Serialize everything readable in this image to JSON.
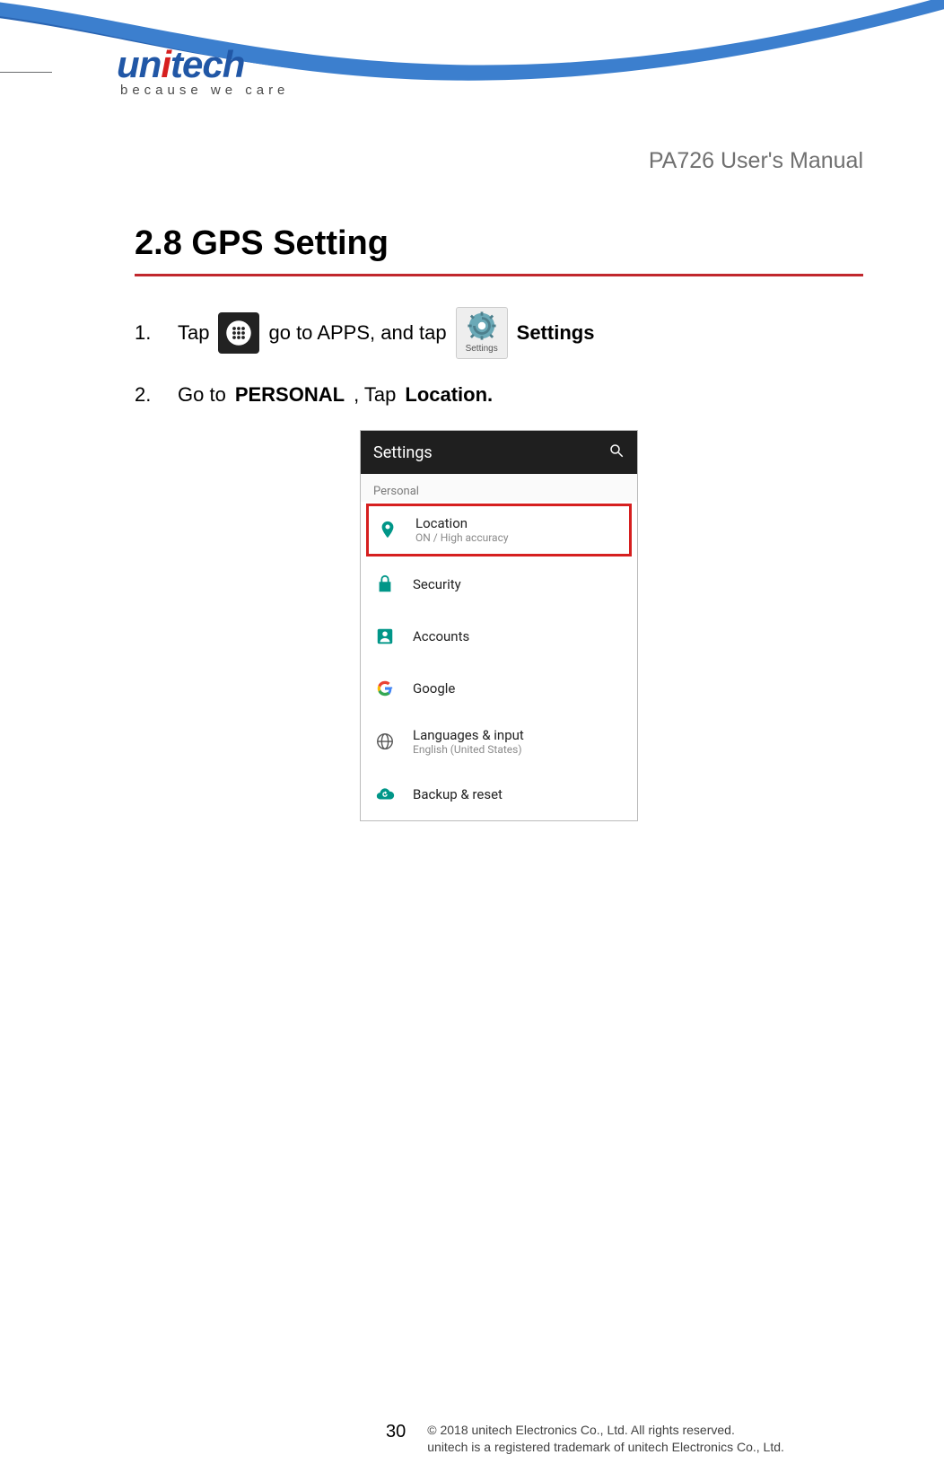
{
  "header": {
    "logo_text_parts": {
      "pre": "un",
      "i": "i",
      "post": "tech"
    },
    "logo_tagline": "because we care",
    "manual_title": "PA726 User's Manual"
  },
  "section": {
    "heading": "2.8 GPS Setting"
  },
  "steps": [
    {
      "num": "1.",
      "pre": "Tap",
      "mid": "go to APPS, and tap",
      "icon1_name": "apps-icon",
      "icon2_name": "settings-app-icon",
      "icon2_label": "Settings",
      "post_bold": "Settings"
    },
    {
      "num": "2.",
      "pre": "Go to",
      "bold1": "PERSONAL",
      "mid": " , Tap ",
      "bold2": "Location."
    }
  ],
  "screenshot": {
    "title": "Settings",
    "section_label": "Personal",
    "rows": [
      {
        "icon": "location-pin",
        "color": "#009688",
        "title": "Location",
        "sub": "ON / High accuracy",
        "highlight": true
      },
      {
        "icon": "lock",
        "color": "#009688",
        "title": "Security",
        "sub": ""
      },
      {
        "icon": "account",
        "color": "#009688",
        "title": "Accounts",
        "sub": ""
      },
      {
        "icon": "google-g",
        "color": "#4285F4",
        "title": "Google",
        "sub": ""
      },
      {
        "icon": "globe",
        "color": "#555",
        "title": "Languages & input",
        "sub": "English (United States)"
      },
      {
        "icon": "cloud-reset",
        "color": "#009688",
        "title": "Backup & reset",
        "sub": ""
      }
    ]
  },
  "footer": {
    "page_number": "30",
    "copyright_line1": "© 2018 unitech Electronics Co., Ltd. All rights reserved.",
    "copyright_line2": "unitech is a registered trademark of unitech Electronics Co., Ltd."
  }
}
